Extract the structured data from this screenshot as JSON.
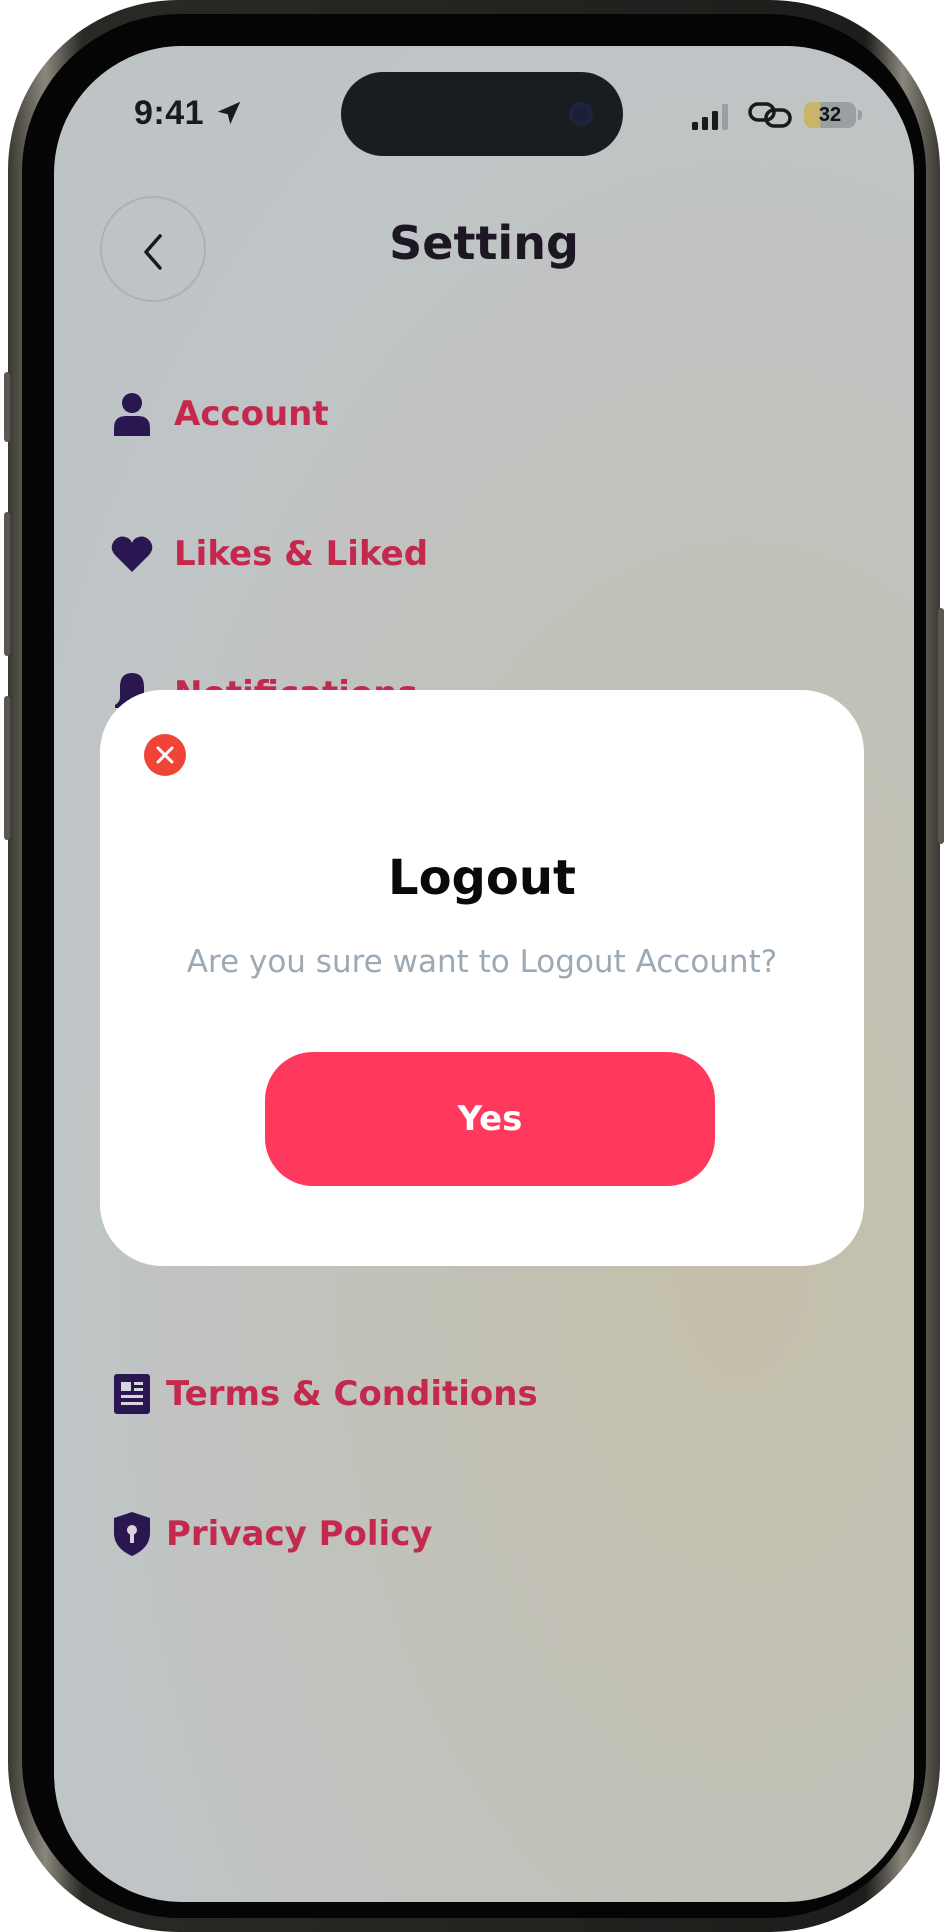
{
  "status_bar": {
    "time": "9:41",
    "battery": "32",
    "icons": [
      "location-arrow-icon",
      "signal-icon",
      "link-icon",
      "battery-icon"
    ]
  },
  "header": {
    "title": "Setting",
    "back_icon": "chevron-left-icon"
  },
  "menu": {
    "items": [
      {
        "label": "Account",
        "icon": "user-icon"
      },
      {
        "label": "Likes & Liked",
        "icon": "heart-icon"
      },
      {
        "label": "Notifications",
        "icon": "bell-icon"
      },
      {
        "label": "Terms & Conditions",
        "icon": "document-icon"
      },
      {
        "label": "Privacy Policy",
        "icon": "shield-icon"
      }
    ]
  },
  "modal": {
    "title": "Logout",
    "message": "Are you sure want to Logout Account?",
    "confirm_label": "Yes",
    "close_icon": "close-icon"
  },
  "colors": {
    "accent": "#ff395d",
    "menu_text": "#c4284d",
    "icon": "#2a1650",
    "close": "#f04437",
    "muted_text": "#9ca9b7"
  }
}
